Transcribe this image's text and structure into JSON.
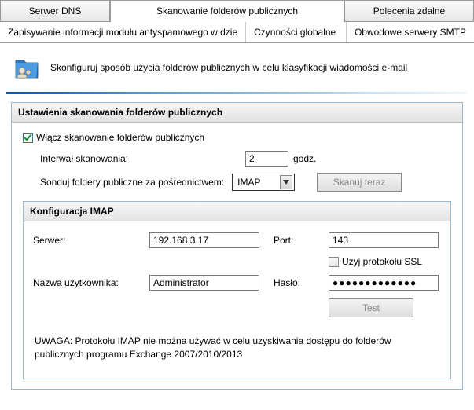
{
  "tabs": {
    "t1": "Serwer DNS",
    "t2": "Skanowanie folderów publicznych",
    "t3": "Polecenia zdalne"
  },
  "subtabs": {
    "s1": "Zapisywanie informacji modułu antyspamowego w dzie",
    "s2": "Czynności globalne",
    "s3": "Obwodowe serwery SMTP"
  },
  "header": "Skonfiguruj sposób użycia folderów publicznych w celu klasyfikacji wiadomości e-mail",
  "settings": {
    "title": "Ustawienia skanowania folderów publicznych",
    "enable": "Włącz skanowanie folderów publicznych",
    "interval_label": "Interwał skanowania:",
    "interval_value": "2",
    "interval_unit": "godz.",
    "poll_label": "Sonduj foldery publiczne za pośrednictwem:",
    "poll_value": "IMAP",
    "scan_now": "Skanuj teraz"
  },
  "imap": {
    "title": "Konfiguracja IMAP",
    "server_label": "Serwer:",
    "server_value": "192.168.3.17",
    "port_label": "Port:",
    "port_value": "143",
    "ssl_label": "Użyj protokołu SSL",
    "user_label": "Nazwa użytkownika:",
    "user_value": "Administrator",
    "pass_label": "Hasło:",
    "pass_value": "●●●●●●●●●●●●●",
    "test": "Test",
    "note": "UWAGA: Protokołu IMAP nie można używać w celu uzyskiwania dostępu do folderów publicznych programu Exchange 2007/2010/2013"
  }
}
